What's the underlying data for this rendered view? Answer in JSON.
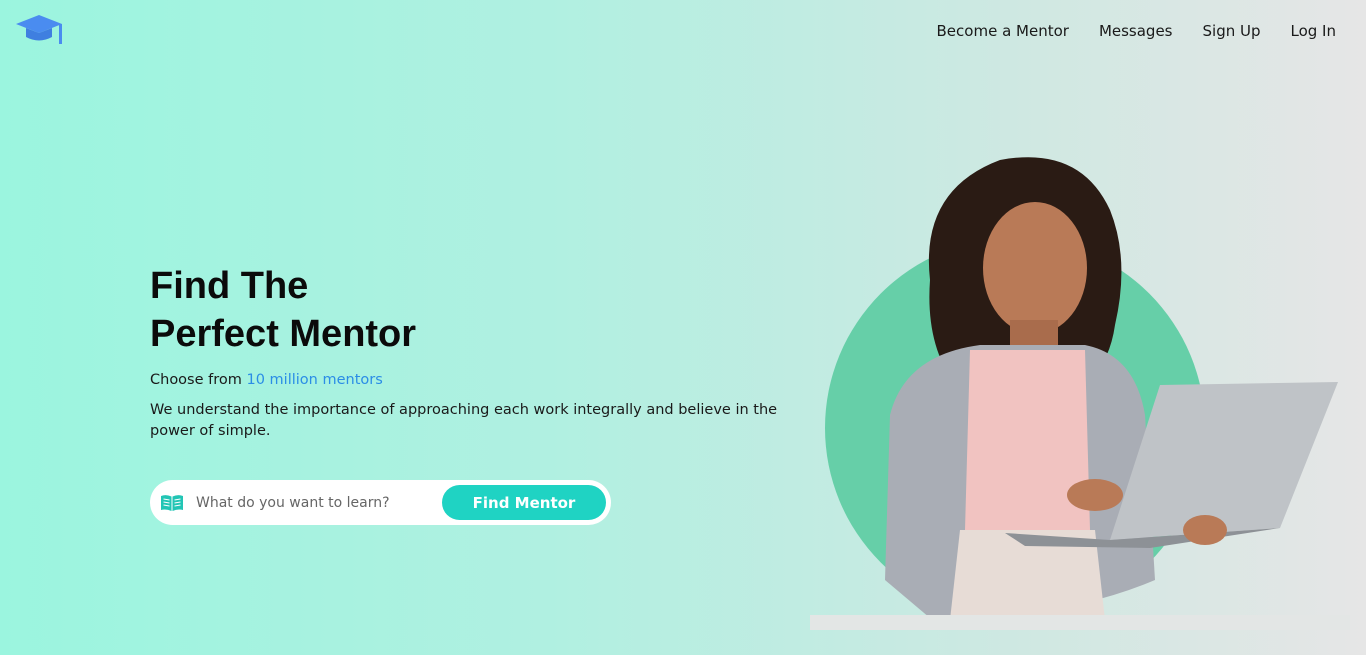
{
  "brand": {
    "logo_icon": "graduation-cap-icon",
    "logo_color": "#4a8cf0"
  },
  "nav": {
    "items": [
      {
        "label": "Become a Mentor"
      },
      {
        "label": "Messages"
      },
      {
        "label": "Sign Up"
      },
      {
        "label": "Log In"
      }
    ]
  },
  "hero": {
    "title_line1": "Find The",
    "title_line2": "Perfect Mentor",
    "choose_prefix": "Choose from ",
    "choose_accent": "10 million mentors",
    "description": "We understand the importance of approaching each work integrally and believe in the power of simple."
  },
  "search": {
    "icon": "book-icon",
    "placeholder": "What do you want to learn?",
    "value": "",
    "button_label": "Find Mentor"
  },
  "colors": {
    "accent_blue": "#2b8de6",
    "button_teal": "#1fd3c3",
    "circle_green": "#66cfa8",
    "background_left": "#9bf5df",
    "background_right": "#e6e6e6"
  }
}
